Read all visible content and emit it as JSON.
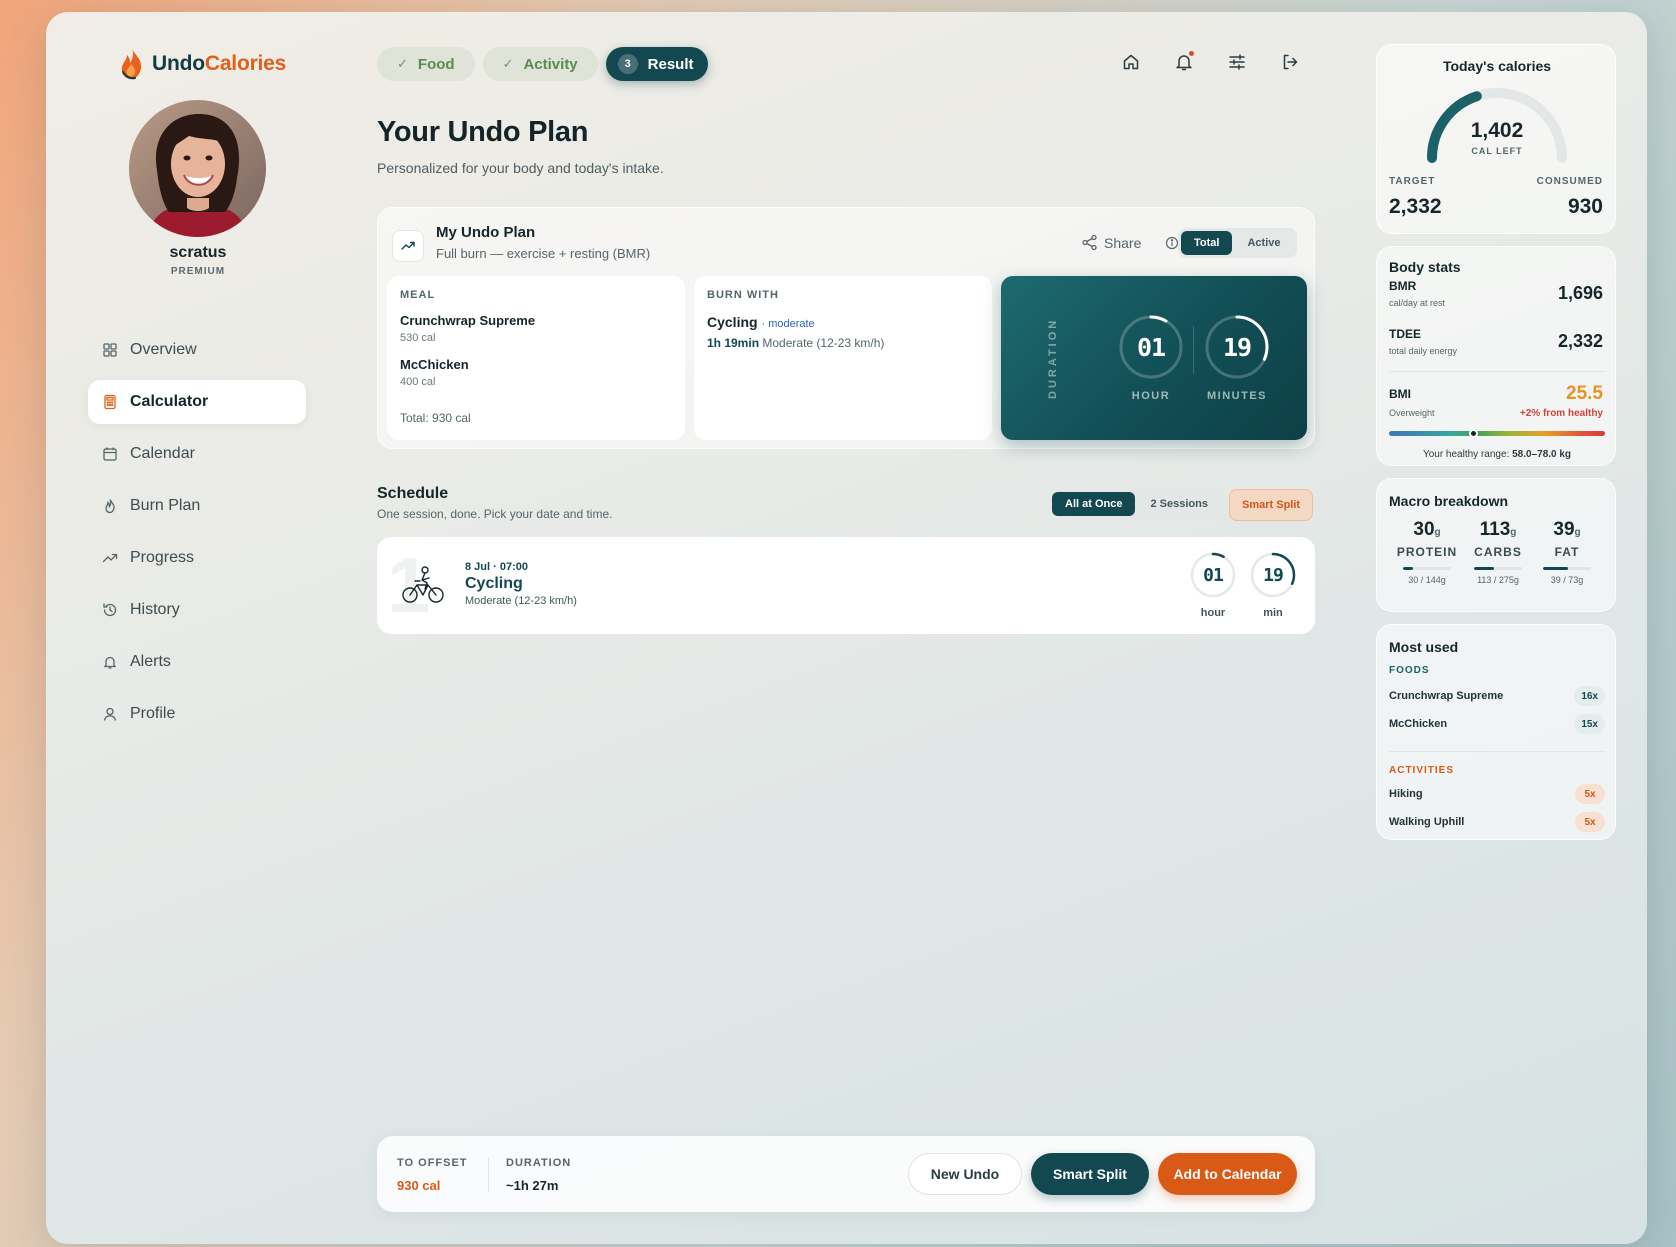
{
  "brand": {
    "undo": "Undo",
    "calories": "Calories"
  },
  "user": {
    "name": "scratus",
    "tier": "PREMIUM"
  },
  "nav": [
    {
      "label": "Overview",
      "icon": "grid-icon"
    },
    {
      "label": "Calculator",
      "icon": "calculator-icon",
      "active": true
    },
    {
      "label": "Calendar",
      "icon": "calendar-icon"
    },
    {
      "label": "Burn Plan",
      "icon": "flame-icon"
    },
    {
      "label": "Progress",
      "icon": "trend-icon"
    },
    {
      "label": "History",
      "icon": "history-icon"
    },
    {
      "label": "Alerts",
      "icon": "bell-icon"
    },
    {
      "label": "Profile",
      "icon": "user-icon"
    }
  ],
  "steps": [
    {
      "label": "Food",
      "mark": "✓"
    },
    {
      "label": "Activity",
      "mark": "✓"
    },
    {
      "label": "Result",
      "mark": "3",
      "active": true
    }
  ],
  "page": {
    "title": "Your Undo Plan",
    "subtitle": "Personalized for your body and today's intake."
  },
  "plan": {
    "title": "My Undo Plan",
    "subtitle": "Full burn — exercise + resting (BMR)",
    "share": "Share",
    "toggle": [
      "Total",
      "Active"
    ],
    "meal_label": "MEAL",
    "meals": [
      {
        "name": "Crunchwrap Supreme",
        "cal": "530 cal"
      },
      {
        "name": "McChicken",
        "cal": "400 cal"
      }
    ],
    "meal_total": "Total: 930 cal",
    "burn_label": "BURN WITH",
    "burn_activity": "Cycling",
    "burn_intensity": "· moderate",
    "burn_time": "1h 19min",
    "burn_desc": "Moderate (12-23 km/h)",
    "duration_label": "DURATION",
    "hours": "01",
    "hours_label": "HOUR",
    "minutes": "19",
    "minutes_label": "MINUTES",
    "hour_fraction": 0.0833,
    "minute_fraction": 0.3167
  },
  "schedule": {
    "title": "Schedule",
    "subtitle": "One session, done. Pick your date and time.",
    "modes": [
      "All at Once",
      "2 Sessions"
    ],
    "smart_split": "Smart Split",
    "session": {
      "index": "1",
      "date": "8 Jul · 07:00",
      "activity": "Cycling",
      "intensity": "Moderate (12-23 km/h)",
      "hours": "01",
      "hours_label": "hour",
      "minutes": "19",
      "minutes_label": "min"
    }
  },
  "footer": {
    "offset_label": "TO OFFSET",
    "offset_value": "930 cal",
    "duration_label": "DURATION",
    "duration_value": "~1h 27m",
    "new_undo": "New Undo",
    "smart_split": "Smart Split",
    "add_calendar": "Add to Calendar"
  },
  "today": {
    "title": "Today's calories",
    "left": "1,402",
    "left_label": "CAL LEFT",
    "target_label": "TARGET",
    "target": "2,332",
    "consumed_label": "CONSUMED",
    "consumed": "930",
    "consumed_fraction": 0.399
  },
  "body_stats": {
    "title": "Body stats",
    "bmr_label": "BMR",
    "bmr_sub": "cal/day at rest",
    "bmr": "1,696",
    "tdee_label": "TDEE",
    "tdee_sub": "total daily energy",
    "tdee": "2,332",
    "bmi_label": "BMI",
    "bmi_sub": "Overweight",
    "bmi": "25.5",
    "bmi_note": "+2% from healthy",
    "range_text": "Your healthy range:",
    "range_value": "58.0–78.0 kg"
  },
  "macros": {
    "title": "Macro breakdown",
    "unit": "g",
    "items": [
      {
        "value": "30",
        "name": "PROTEIN",
        "sub": "30 / 144g",
        "fraction": 0.21
      },
      {
        "value": "113",
        "name": "CARBS",
        "sub": "113 / 275g",
        "fraction": 0.41
      },
      {
        "value": "39",
        "name": "FAT",
        "sub": "39 / 73g",
        "fraction": 0.53
      }
    ]
  },
  "most_used": {
    "title": "Most used",
    "foods_label": "FOODS",
    "foods": [
      {
        "name": "Crunchwrap Supreme",
        "count": "16x"
      },
      {
        "name": "McChicken",
        "count": "15x"
      }
    ],
    "activities_label": "ACTIVITIES",
    "activities": [
      {
        "name": "Hiking",
        "count": "5x"
      },
      {
        "name": "Walking Uphill",
        "count": "5x"
      }
    ]
  },
  "colors": {
    "teal": "#134850",
    "orange": "#d85a16",
    "bmi": "#e8931e"
  }
}
